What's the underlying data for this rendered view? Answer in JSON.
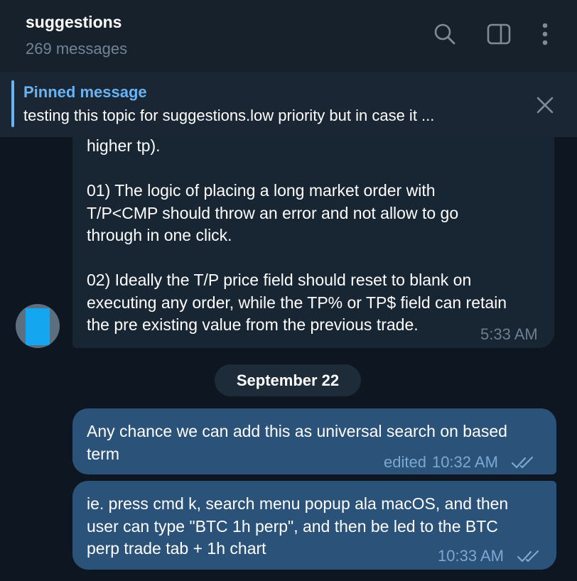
{
  "header": {
    "title": "suggestions",
    "subtitle": "269 messages",
    "icons": [
      "search-icon",
      "sidebar-toggle-icon",
      "more-vert-icon"
    ]
  },
  "pinned": {
    "title": "Pinned message",
    "text": "testing this topic for suggestions.low priority but in case it ..."
  },
  "messages": {
    "incoming": {
      "lines": [
        "higher tp).",
        "",
        "01) The logic of placing a long market order with",
        "T/P<CMP should throw an error and not allow to go",
        "through in one click.",
        "",
        "02) Ideally the T/P price field should reset to blank on",
        "executing any order, while the TP% or TP$ field can retain",
        "the pre existing value from the previous trade."
      ],
      "time": "5:33 AM"
    },
    "date_separator": "September 22",
    "outgoing": [
      {
        "lines": [
          "Any chance we can add this as universal search on based",
          "term"
        ],
        "edited": "edited",
        "time": "10:32 AM"
      },
      {
        "lines": [
          "ie. press cmd k, search menu popup ala macOS, and then",
          "user can type \"BTC 1h perp\", and then be led to the BTC",
          "perp trade tab + 1h chart"
        ],
        "time": "10:33 AM"
      }
    ]
  },
  "colors": {
    "background": "#0e1621",
    "header": "#17212b",
    "incoming_bubble": "#182533",
    "outgoing_bubble": "#2b5278",
    "accent": "#6ab3f3"
  }
}
